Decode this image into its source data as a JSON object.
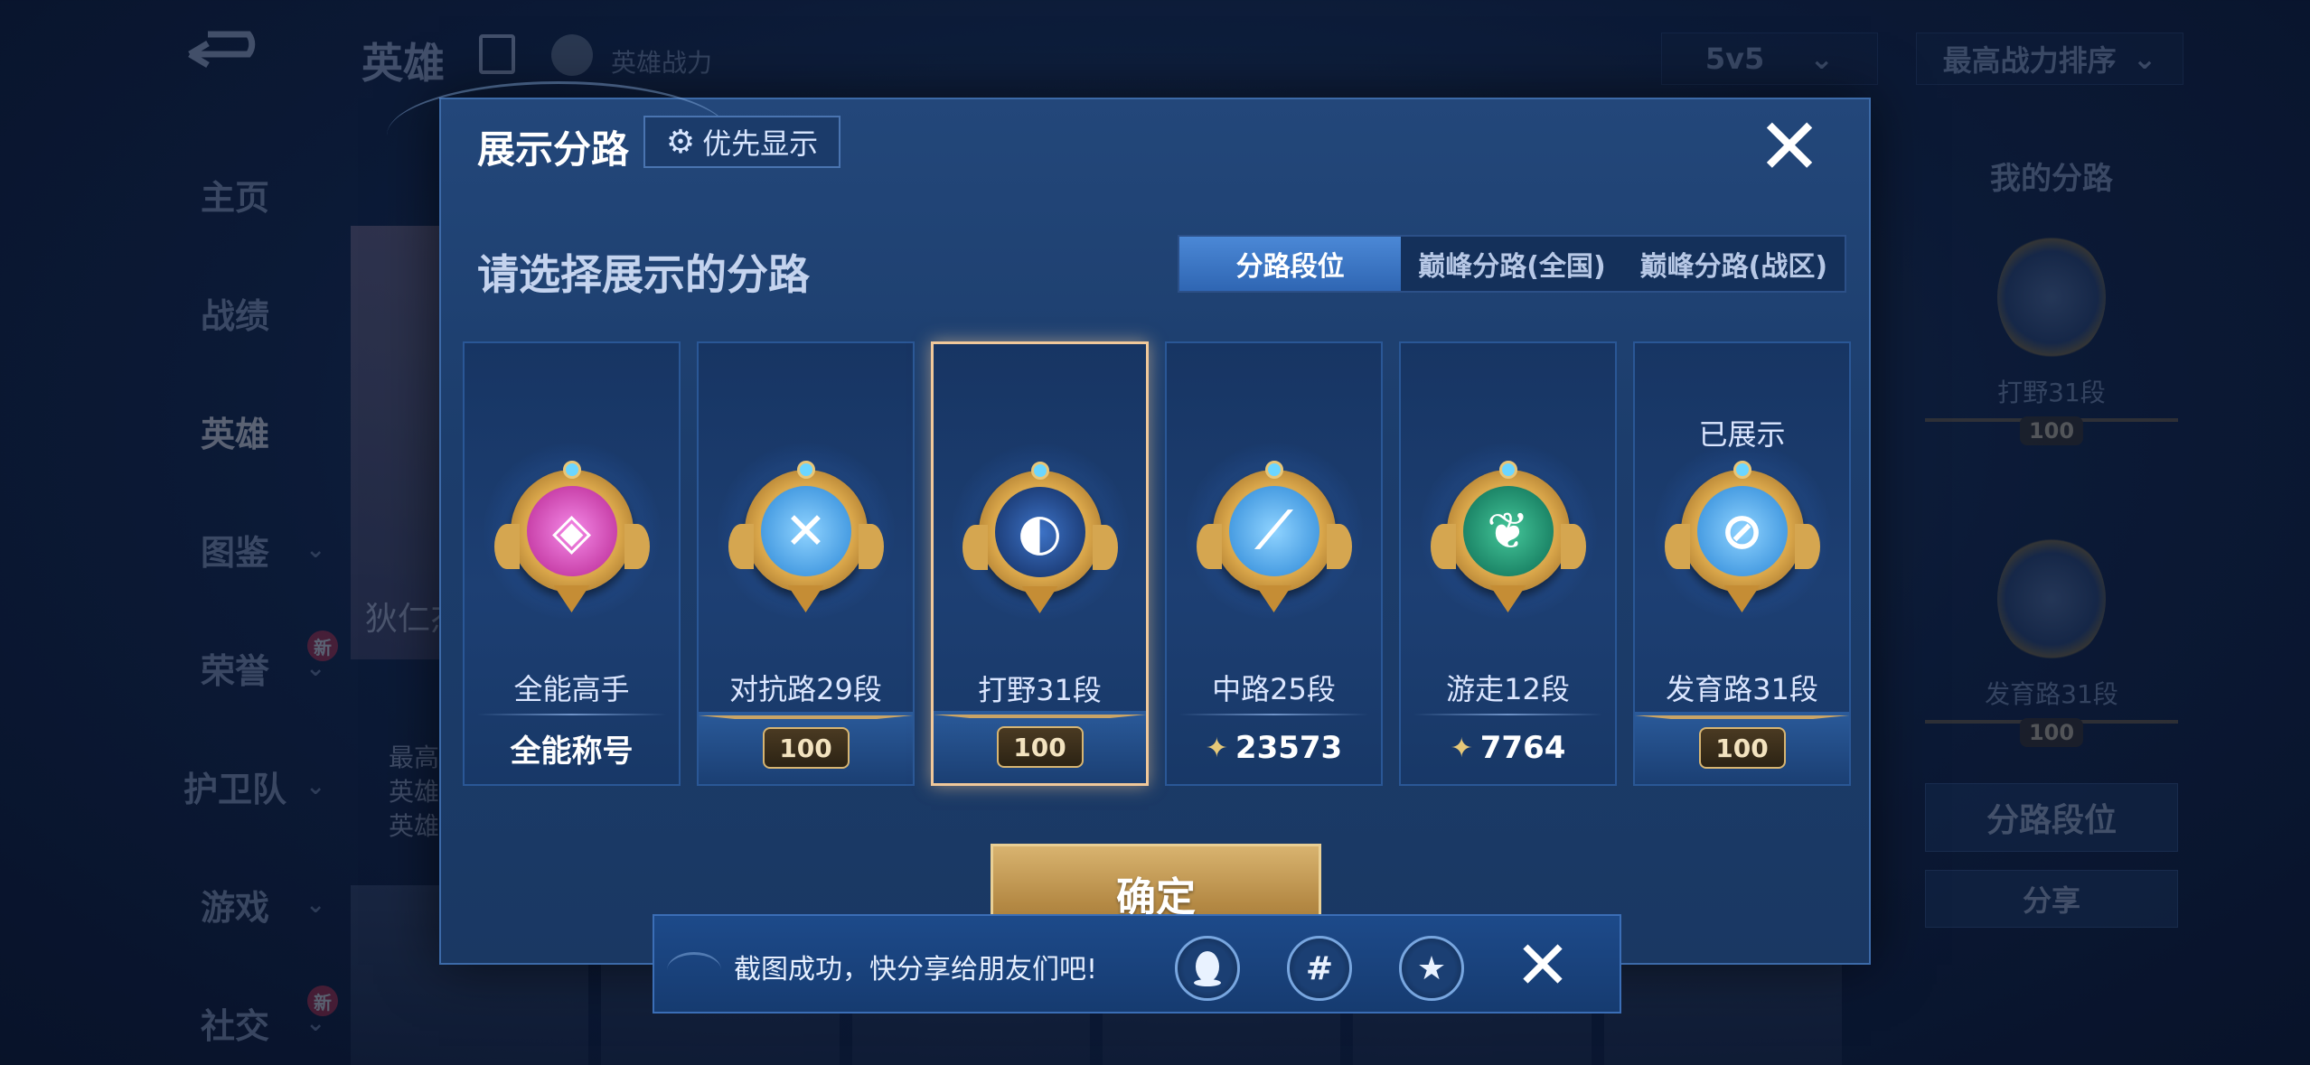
{
  "background": {
    "top_title": "英雄",
    "hero_power": "英雄战力",
    "mode_select": "5v5",
    "sort_select": "最高战力排序",
    "nav": [
      {
        "label": "主页",
        "chevron": false,
        "new": false,
        "active": false
      },
      {
        "label": "战绩",
        "chevron": false,
        "new": false,
        "active": false
      },
      {
        "label": "英雄",
        "chevron": false,
        "new": false,
        "active": true
      },
      {
        "label": "图鉴",
        "chevron": true,
        "new": false,
        "active": false
      },
      {
        "label": "荣誉",
        "chevron": true,
        "new": true,
        "active": false
      },
      {
        "label": "护卫队",
        "chevron": true,
        "new": false,
        "active": false
      },
      {
        "label": "游戏",
        "chevron": true,
        "new": false,
        "active": false
      },
      {
        "label": "社交",
        "chevron": true,
        "new": true,
        "active": false
      }
    ],
    "new_badge": "新",
    "hero_name": "狄仁杰",
    "hero_stats": [
      "最高",
      "英雄",
      "英雄"
    ],
    "right_panel": {
      "title": "我的分路",
      "items": [
        {
          "label": "打野31段",
          "rank": "100"
        },
        {
          "label": "发育路31段",
          "rank": "100"
        }
      ],
      "buttons": [
        "分路段位",
        "分享"
      ]
    }
  },
  "modal": {
    "title": "展示分路",
    "priority_button": "优先显示",
    "subtitle": "请选择展示的分路",
    "tabs": [
      {
        "label": "分路段位",
        "active": true
      },
      {
        "label": "巅峰分路(全国)",
        "active": false
      },
      {
        "label": "巅峰分路(战区)",
        "active": false
      }
    ],
    "cards": [
      {
        "label": "全能高手",
        "icon": "all-round-icon",
        "color": "pink",
        "plate_type": "text",
        "plate_value": "全能称号",
        "shown": "",
        "selected": false
      },
      {
        "label": "对抗路29段",
        "icon": "clash-lane-icon",
        "color": "blue",
        "plate_type": "rank",
        "plate_value": "100",
        "shown": "",
        "selected": false
      },
      {
        "label": "打野31段",
        "icon": "jungle-icon",
        "color": "navy",
        "plate_type": "rank",
        "plate_value": "100",
        "shown": "",
        "selected": true
      },
      {
        "label": "中路25段",
        "icon": "mid-lane-icon",
        "color": "blue",
        "plate_type": "score",
        "plate_value": "23573",
        "shown": "",
        "selected": false
      },
      {
        "label": "游走12段",
        "icon": "roam-icon",
        "color": "green",
        "plate_type": "score",
        "plate_value": "7764",
        "shown": "",
        "selected": false
      },
      {
        "label": "发育路31段",
        "icon": "farm-lane-icon",
        "color": "blue",
        "plate_type": "rank",
        "plate_value": "100",
        "shown": "已展示",
        "selected": false
      }
    ],
    "confirm_button": "确定"
  },
  "toast": {
    "message": "截图成功，快分享给朋友们吧!",
    "share_targets": [
      "qq-icon",
      "wechat-moments-icon",
      "qzone-icon"
    ]
  },
  "colors": {
    "accent_blue": "#2f66b3",
    "gold": "#d7b572",
    "selected_border": "#f0c89a"
  }
}
